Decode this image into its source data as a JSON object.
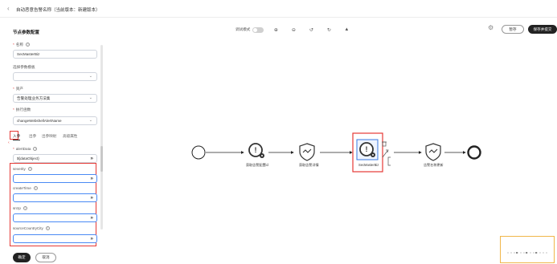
{
  "header": {
    "back_icon": "chevron-left-icon",
    "title": "自动恶意告警名称（当前版本：新建版本）"
  },
  "toolbar": {
    "debug_mode_label": "调试模式",
    "debug_mode_on": false,
    "icons": [
      "zoom-in-icon",
      "zoom-out-icon",
      "undo-icon",
      "redo-icon",
      "fit-view-icon"
    ],
    "settings_icon": "gear-icon",
    "pause_label": "暂存",
    "save_submit_label": "保存并提交"
  },
  "panel": {
    "title": "节点参数配置",
    "name_label": "名称",
    "name_value": "SecMasterBiz",
    "template_label": "选择参数模板",
    "template_value": "",
    "asset_label": "资产",
    "asset_value": "告警处理业务方法集",
    "function_label": "执行函数",
    "function_value": "changeWebshellAlertName",
    "tabs": [
      "入参",
      "出参",
      "出参映射",
      "高级属性"
    ],
    "active_tab": "入参",
    "params": [
      {
        "name": "alertData",
        "required": true,
        "value": "${dataObject}"
      },
      {
        "name": "severity",
        "required": false,
        "value": ""
      },
      {
        "name": "createTime",
        "required": false,
        "value": ""
      },
      {
        "name": "srcIp",
        "required": false,
        "value": ""
      },
      {
        "name": "sourceCountryCity",
        "required": false,
        "value": ""
      }
    ],
    "confirm_label": "确定",
    "cancel_label": "取消"
  },
  "flow": {
    "nodes": [
      {
        "id": "start",
        "type": "start"
      },
      {
        "id": "n1",
        "type": "task",
        "label": "获取告警配置id"
      },
      {
        "id": "n2",
        "type": "shield",
        "label": "获取告警详情"
      },
      {
        "id": "n3",
        "type": "task",
        "label": "SecMasterBiz",
        "selected": true
      },
      {
        "id": "n4",
        "type": "shield",
        "label": "告警名称更新"
      },
      {
        "id": "end",
        "type": "end"
      }
    ]
  }
}
